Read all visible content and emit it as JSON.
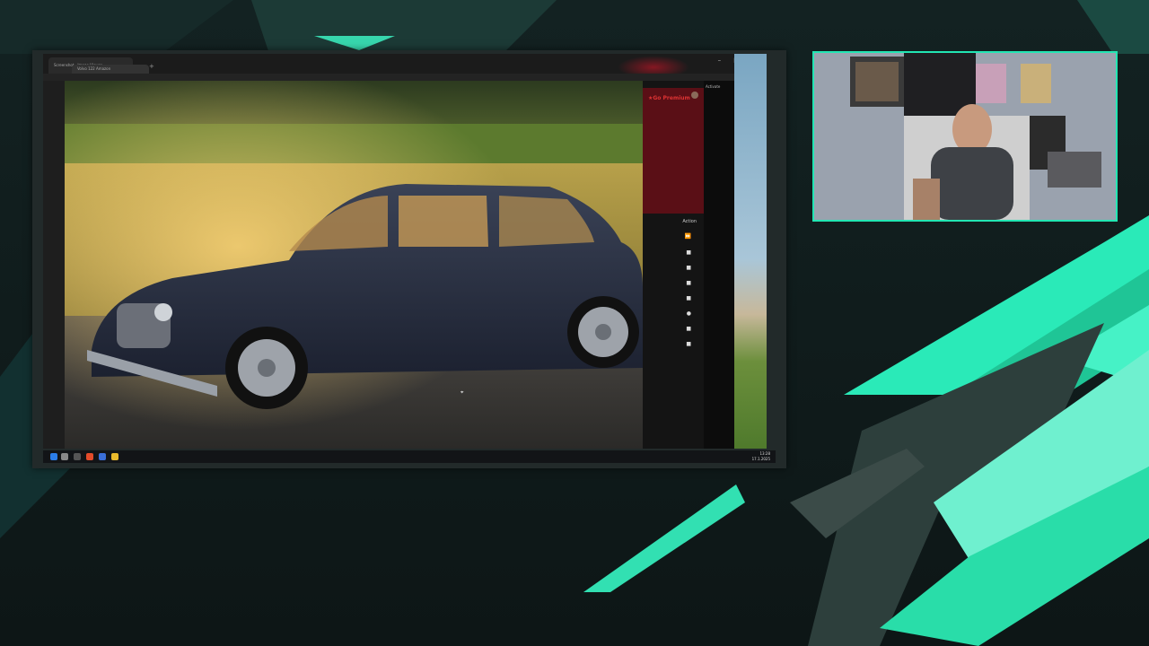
{
  "browser": {
    "tab_title": "Screenshot - Image Viewer",
    "tab2_title": "Volvo 122 Amazon",
    "new_tab": "+",
    "window_controls": "– □ ✕"
  },
  "premium_panel": {
    "go_premium": "★Go Premium",
    "action_label": "Action"
  },
  "right_pane": {
    "label": "Activate"
  },
  "taskbar": {
    "time": "13:28",
    "date": "17.1.2025"
  },
  "colors": {
    "accent": "#22e6b3",
    "background": "#132222",
    "premium_red": "#5a0f16"
  },
  "icons": [
    "windows-start-icon",
    "search-icon",
    "chrome-icon",
    "firefox-icon",
    "folder-icon",
    "app-icon"
  ]
}
